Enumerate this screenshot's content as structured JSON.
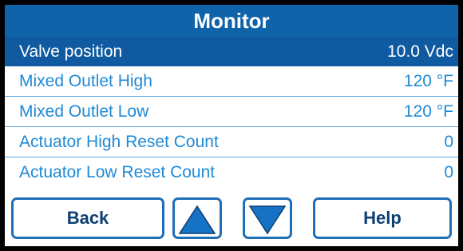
{
  "title": "Monitor",
  "rows": [
    {
      "label": "Valve position",
      "value": "10.0 Vdc",
      "selected": true
    },
    {
      "label": "Mixed Outlet High",
      "value": "120 °F",
      "selected": false
    },
    {
      "label": "Mixed Outlet Low",
      "value": "120 °F",
      "selected": false
    },
    {
      "label": "Actuator High Reset Count",
      "value": "0",
      "selected": false
    },
    {
      "label": "Actuator Low Reset Count",
      "value": "0",
      "selected": false
    }
  ],
  "buttons": {
    "back_label": "Back",
    "up_icon": "up-arrow-icon",
    "down_icon": "down-arrow-icon",
    "help_label": "Help"
  },
  "colors": {
    "header": "#0f63a9",
    "selected_row": "#0f5aa0",
    "row_text": "#1f8ad6",
    "button_border": "#1f6fb8",
    "arrow_fill": "#1572c4"
  }
}
